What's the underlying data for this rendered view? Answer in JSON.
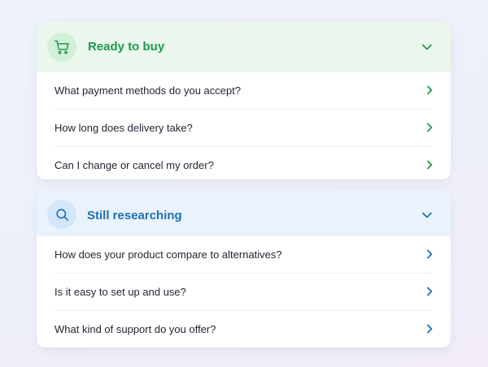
{
  "sections": [
    {
      "title": "Ready to buy",
      "icon": "cart-icon",
      "accent": "#1f9a4d",
      "questions": [
        "What payment methods do you accept?",
        "How long does delivery take?",
        "Can I change or cancel my order?"
      ]
    },
    {
      "title": "Still researching",
      "icon": "search-icon",
      "accent": "#1f6fae",
      "questions": [
        "How does your product compare to alternatives?",
        "Is it easy to set up and use?",
        "What kind of support do you offer?"
      ]
    }
  ]
}
